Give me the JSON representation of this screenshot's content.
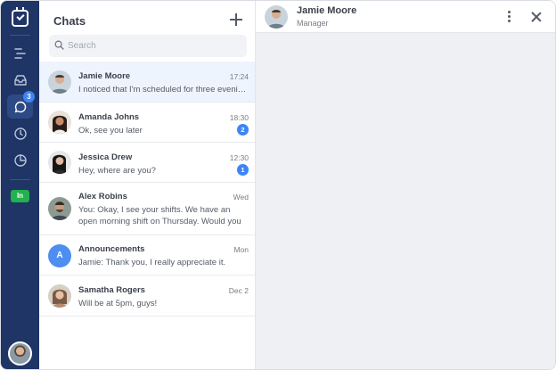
{
  "rail": {
    "logo_icon": "calendar-check-icon",
    "items": [
      {
        "icon": "schedule-icon"
      },
      {
        "icon": "inbox-icon"
      },
      {
        "icon": "chat-icon",
        "badge": "3"
      },
      {
        "icon": "clock-icon"
      },
      {
        "icon": "reports-icon"
      }
    ],
    "clock_in_label": "In",
    "accent": "#1f3566"
  },
  "chats": {
    "title": "Chats",
    "search_placeholder": "Search",
    "items": [
      {
        "name": "Jamie Moore",
        "time": "17:24",
        "preview": "I noticed that I'm scheduled for three evening shifts",
        "unread": ""
      },
      {
        "name": "Amanda Johns",
        "time": "18:30",
        "preview": "Ok, see you later",
        "unread": "2"
      },
      {
        "name": "Jessica Drew",
        "time": "12:30",
        "preview": "Hey, where are you?",
        "unread": "1"
      },
      {
        "name": "Alex Robins",
        "time": "Wed",
        "preview": "You: Okay, I see your shifts. We have an open morning shift on Thursday. Would you be ab...",
        "unread": ""
      },
      {
        "name": "Announcements",
        "avatar_letter": "A",
        "time": "Mon",
        "preview": "Jamie: Thank you, I really appreciate it.",
        "unread": ""
      },
      {
        "name": "Samatha Rogers",
        "time": "Dec 2",
        "preview": "Will be at 5pm, guys!",
        "unread": ""
      }
    ]
  },
  "conversation": {
    "name": "Jamie Moore",
    "role": "Manager"
  },
  "colors": {
    "badge_blue": "#3d84f5",
    "clock_in_green": "#22b14c",
    "selected_row": "#eef4fd"
  }
}
